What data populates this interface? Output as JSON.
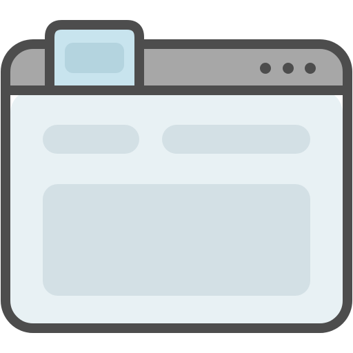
{
  "icon": {
    "name": "browser-window-icon",
    "tab_count": 1,
    "window_control_dots": 3,
    "content_placeholder_blocks": 3
  },
  "colors": {
    "outline": "#4d4d4d",
    "title_bar": "#a7a7a7",
    "window_body": "#e8f1f4",
    "tab_outer": "#c8e4ee",
    "tab_inner": "#b4d4df",
    "placeholder": "#d3e0e5"
  }
}
